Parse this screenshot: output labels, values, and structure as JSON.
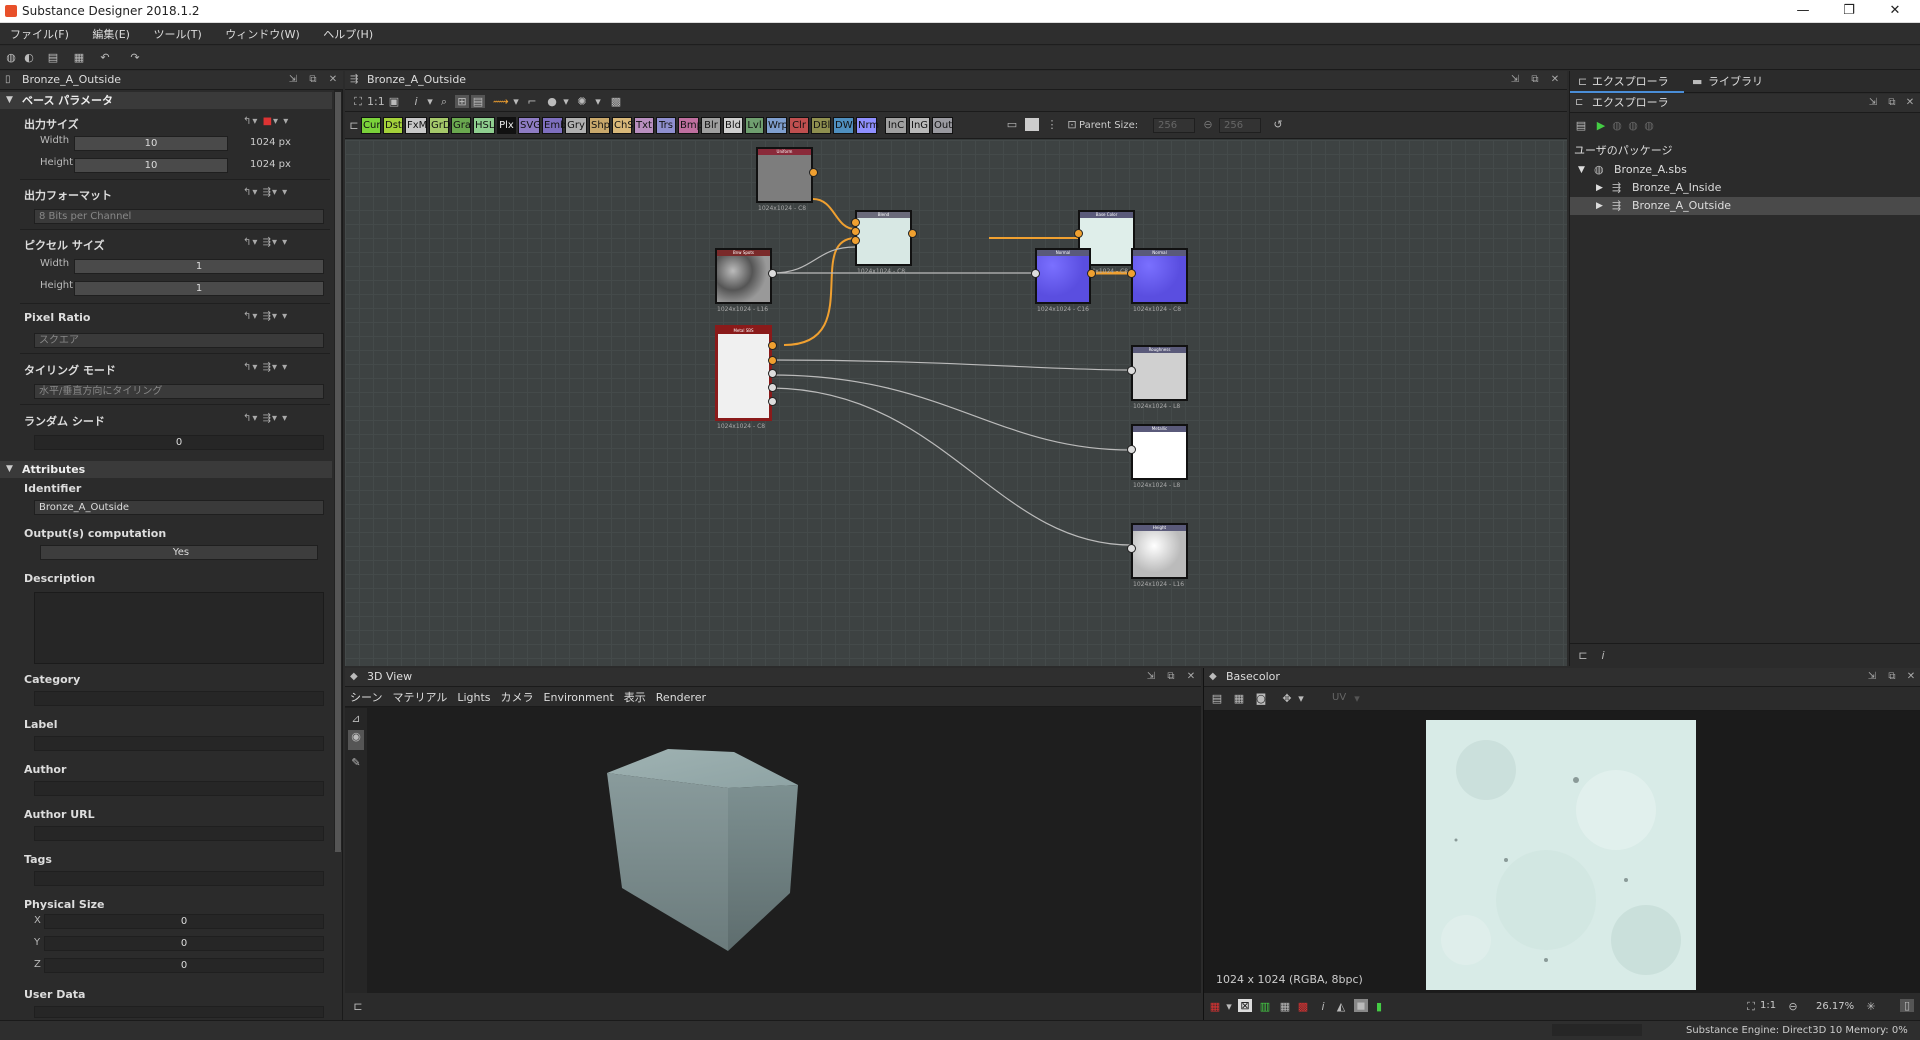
{
  "window": {
    "title": "Substance Designer 2018.1.2",
    "min": "—",
    "max": "❐",
    "close": "✕"
  },
  "menu": [
    "ファイル(F)",
    "編集(E)",
    "ツール(T)",
    "ウィンドウ(W)",
    "ヘルプ(H)"
  ],
  "left_panel": {
    "title": "Bronze_A_Outside",
    "section_base": "ベース パラメータ",
    "output_size": {
      "label": "出力サイズ",
      "width_label": "Width",
      "width_value": "10",
      "width_unit": "1024 px",
      "height_label": "Height",
      "height_value": "10",
      "height_unit": "1024 px"
    },
    "output_format": {
      "label": "出力フォーマット",
      "value": "8 Bits per Channel"
    },
    "pixel_size": {
      "label": "ピクセル サイズ",
      "width_label": "Width",
      "width_value": "1",
      "height_label": "Height",
      "height_value": "1"
    },
    "pixel_ratio": {
      "label": "Pixel Ratio",
      "value": "スクエア"
    },
    "tiling_mode": {
      "label": "タイリング モード",
      "value": "水平/垂直方向にタイリング"
    },
    "random_seed": {
      "label": "ランダム シード",
      "value": "0"
    },
    "section_attributes": "Attributes",
    "identifier": {
      "label": "Identifier",
      "value": "Bronze_A_Outside"
    },
    "outputs_computation": {
      "label": "Output(s) computation",
      "value": "Yes"
    },
    "description_label": "Description",
    "category_label": "Category",
    "label_label": "Label",
    "author_label": "Author",
    "author_url_label": "Author URL",
    "tags_label": "Tags",
    "physical_size": {
      "label": "Physical Size",
      "x_label": "X",
      "x_value": "0",
      "y_label": "Y",
      "y_value": "0",
      "z_label": "Z",
      "z_value": "0"
    },
    "user_data_label": "User Data"
  },
  "graph": {
    "title": "Bronze_A_Outside",
    "ratio_label": "1:1",
    "info_label": "i",
    "atomic_nodes": [
      {
        "label": "Cur",
        "color": "#7ad13a"
      },
      {
        "label": "Dst",
        "color": "#a4d13a"
      },
      {
        "label": "FxM",
        "color": "#c8c8c8"
      },
      {
        "label": "GrD",
        "color": "#a5c86a"
      },
      {
        "label": "Gra",
        "color": "#6aa84f"
      },
      {
        "label": "HSL",
        "color": "#8fcf8f"
      },
      {
        "label": "Plx",
        "color": "#111111"
      },
      {
        "label": "SVG",
        "color": "#8e7cc3"
      },
      {
        "label": "Emb",
        "color": "#7e6fbf"
      },
      {
        "label": "Gry",
        "color": "#b0b0b0"
      },
      {
        "label": "Shp",
        "color": "#c9a86b"
      },
      {
        "label": "ChS",
        "color": "#d9b879"
      },
      {
        "label": "Txt",
        "color": "#b98fbf"
      },
      {
        "label": "Trs",
        "color": "#8f8fcf"
      },
      {
        "label": "Bmp",
        "color": "#bf6f9f"
      },
      {
        "label": "Blr",
        "color": "#9f9f9f"
      },
      {
        "label": "Bld",
        "color": "#cfcfcf"
      },
      {
        "label": "Lvl",
        "color": "#6f9f6f"
      },
      {
        "label": "Wrp",
        "color": "#7f9fcf"
      },
      {
        "label": "Clr",
        "color": "#bf4f4f"
      },
      {
        "label": "DBl",
        "color": "#8f8f4f"
      },
      {
        "label": "DWr",
        "color": "#4f8fbf"
      },
      {
        "label": "Nrm",
        "color": "#8f8fff"
      },
      {
        "label": "InC",
        "color": "#a0a0a0"
      },
      {
        "label": "InG",
        "color": "#b8b8b8"
      },
      {
        "label": "Out",
        "color": "#9a9aa0"
      }
    ],
    "parent_size_label": "Parent Size:",
    "parent_size_w": "256",
    "parent_size_h": "256",
    "nodes": [
      {
        "name": "uniform-color-node",
        "title": "Uniform",
        "caption": "1024x1024 - C8",
        "head": "#8a2a3a",
        "fill": "#7d7d7d"
      },
      {
        "name": "blend-node",
        "title": "Blend",
        "caption": "1024x1024 - C8",
        "head": "#6a6a7a",
        "fill": "#d8e8e4"
      },
      {
        "name": "basecolor-output-node",
        "title": "Base Color",
        "caption": "1024x1024 - C8",
        "head": "#5a5a7a",
        "fill": "#dfeeea"
      },
      {
        "name": "bitmap-node",
        "title": "Bnw Spots",
        "caption": "1024x1024 - L16",
        "head": "#7a2a2a",
        "fill": "#6a6a6a"
      },
      {
        "name": "normal-node",
        "title": "Normal",
        "caption": "1024x1024 - C16",
        "head": "#5a5a7a",
        "fill": "#6a5ee0"
      },
      {
        "name": "normal-output-node",
        "title": "Normal",
        "caption": "1024x1024 - C8",
        "head": "#5a5a7a",
        "fill": "#6a5ee0"
      },
      {
        "name": "multi-output-node",
        "title": "Metal SBS",
        "caption": "1024x1024 - C8",
        "head": "#8a1a1a",
        "fill": "#f0f0f0"
      },
      {
        "name": "roughness-output-node",
        "title": "Roughness",
        "caption": "1024x1024 - L8",
        "head": "#5a5a7a",
        "fill": "#d0d0d0"
      },
      {
        "name": "metallic-output-node",
        "title": "Metallic",
        "caption": "1024x1024 - L8",
        "head": "#5a5a7a",
        "fill": "#ffffff"
      },
      {
        "name": "height-output-node",
        "title": "Height",
        "caption": "1024x1024 - L16",
        "head": "#5a5a7a",
        "fill": "#e0e0e0"
      }
    ]
  },
  "explorer": {
    "tab_explorer": "エクスプローラ",
    "tab_library": "ライブラリ",
    "title": "エクスプローラ",
    "user_packages": "ユーザのパッケージ",
    "package": "Bronze_A.sbs",
    "graphs": [
      "Bronze_A_Inside",
      "Bronze_A_Outside"
    ]
  },
  "view3d": {
    "title": "3D View",
    "menu": [
      "シーン",
      "マテリアル",
      "Lights",
      "カメラ",
      "Environment",
      "表示",
      "Renderer"
    ]
  },
  "view2d": {
    "title": "Basecolor",
    "uv_label": "UV",
    "resolution": "1024 x 1024 (RGBA, 8bpc)",
    "ratio_label": "1:1",
    "zoom": "26.17%"
  },
  "status": "Substance Engine: Direct3D 10  Memory: 0%",
  "colors": {
    "accent": "#f0a030",
    "selection": "#4a4a4a",
    "window_bg": "#2b2b2b"
  }
}
